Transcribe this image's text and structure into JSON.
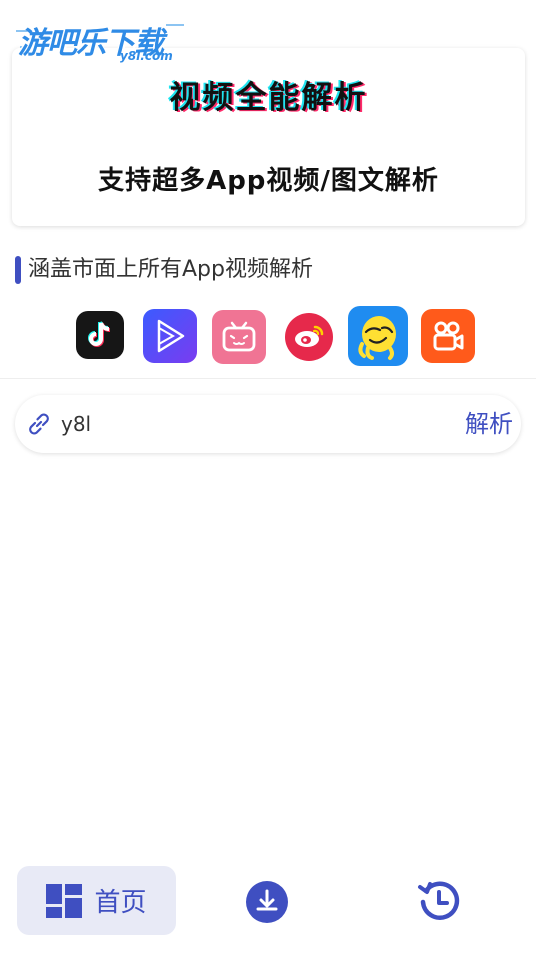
{
  "watermark": {
    "text": "游吧乐下载",
    "sub": "y8l.com"
  },
  "banner": {
    "title": "视频全能解析",
    "subtitle": "支持超多App视频/图文解析"
  },
  "section": {
    "title": "涵盖市面上所有App视频解析"
  },
  "apps": [
    {
      "name": "douyin-icon",
      "color": "#1a1a1a"
    },
    {
      "name": "video-player-icon",
      "color": "#4f44e8"
    },
    {
      "name": "bilibili-icon",
      "color": "#f07494"
    },
    {
      "name": "weibo-icon",
      "color": "#e6294b"
    },
    {
      "name": "pipixia-icon",
      "color": "#1f8cf0"
    },
    {
      "name": "kuaishou-icon",
      "color": "#ff5a1b"
    }
  ],
  "input": {
    "value": "y8l",
    "action": "解析"
  },
  "nav": {
    "home_label": "首页"
  },
  "colors": {
    "accent": "#3f4fc1",
    "accent_light": "#e8eaf6"
  }
}
